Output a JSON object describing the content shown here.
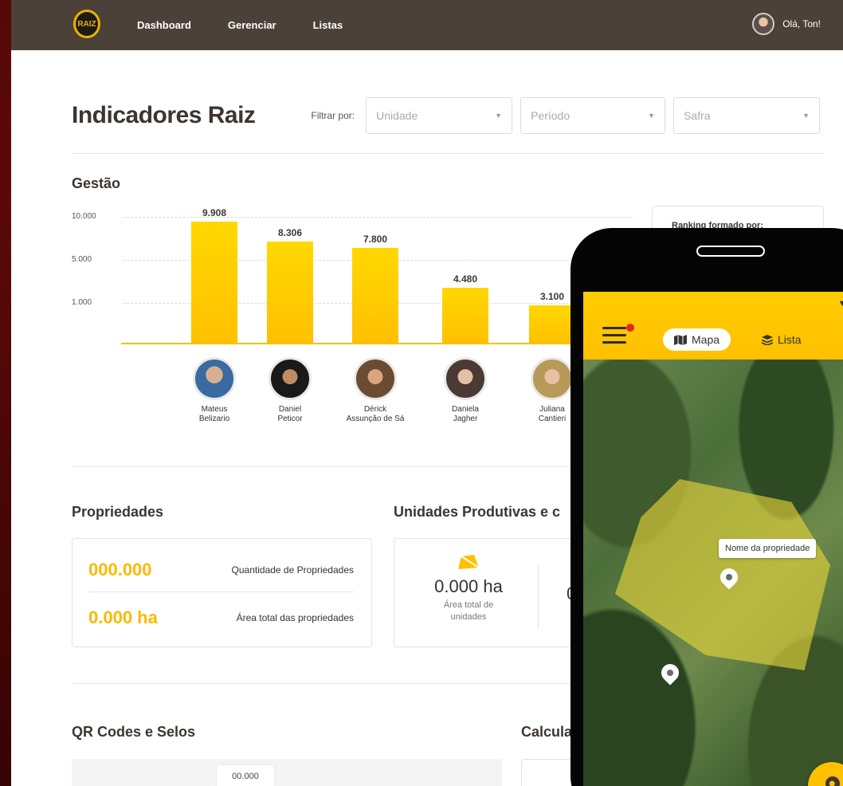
{
  "nav": {
    "logo_text": "RAIZ",
    "items": [
      "Dashboard",
      "Gerenciar",
      "Listas"
    ],
    "user_greeting": "Olá, Ton!"
  },
  "header": {
    "title": "Indicadores Raiz",
    "filter_label": "Filtrar por:",
    "filters": [
      {
        "placeholder": "Unidade"
      },
      {
        "placeholder": "Período"
      },
      {
        "placeholder": "Safra"
      }
    ]
  },
  "gestao": {
    "title": "Gestão",
    "ranking_title": "Ranking formado por:"
  },
  "chart_data": {
    "type": "bar",
    "yticks": [
      "10.000",
      "5.000",
      "1.000"
    ],
    "categories": [
      "Mateus Belizario",
      "Daniel Peticor",
      "Dérick Assunção de Sá",
      "Daniela Jagher",
      "Juliana Cantieri"
    ],
    "name_lines": [
      [
        "Mateus",
        "Belizario"
      ],
      [
        "Daniel",
        "Peticor"
      ],
      [
        "Dérick",
        "Assunção de Sá"
      ],
      [
        "Daniela",
        "Jagher"
      ],
      [
        "Juliana",
        "Cantieri"
      ]
    ],
    "values": [
      9908,
      8306,
      7800,
      4480,
      3100
    ],
    "value_labels": [
      "9.908",
      "8.306",
      "7.800",
      "4.480",
      "3.100"
    ],
    "bar_color": "#ffc400"
  },
  "propriedades": {
    "title": "Propriedades",
    "rows": [
      {
        "value": "000.000",
        "label": "Quantidade de Propriedades"
      },
      {
        "value": "0.000 ha",
        "label": "Área total das propriedades"
      }
    ]
  },
  "unidades": {
    "title": "Unidades Produtivas e c",
    "col1_value": "0.000 ha",
    "col1_desc_line1": "Área total de",
    "col1_desc_line2": "unidades",
    "col2_value_partial": "0"
  },
  "qr": {
    "title": "QR Codes e Selos",
    "badge": "00.000"
  },
  "calc": {
    "title_partial": "Calcula"
  },
  "phone": {
    "tabs": [
      {
        "label": "Mapa",
        "icon": "map-icon"
      },
      {
        "label": "Lista",
        "icon": "layers-icon"
      }
    ],
    "tooltip": "Nome da propriedade",
    "status_icons": "▼◢▮"
  },
  "colors": {
    "topbar": "#4b4139",
    "accent": "#ffc000",
    "text_dark": "#3d3530"
  }
}
